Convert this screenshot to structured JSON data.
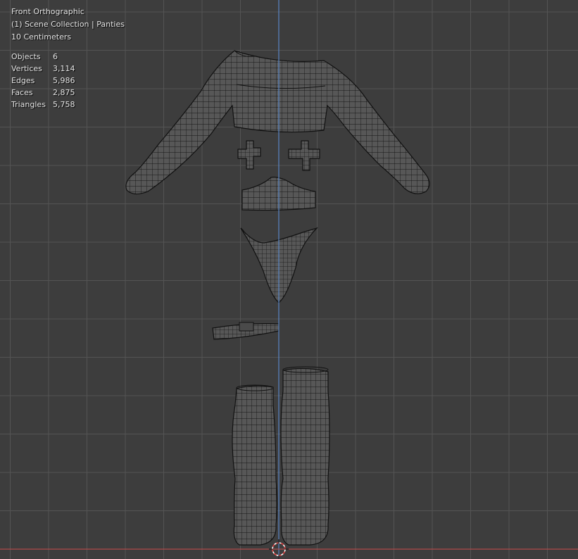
{
  "viewport": {
    "view_name": "Front Orthographic",
    "collection_line": "(1) Scene Collection | Panties",
    "grid_scale": "10 Centimeters"
  },
  "stats": [
    {
      "label": "Objects",
      "value": "6"
    },
    {
      "label": "Vertices",
      "value": "3,114"
    },
    {
      "label": "Edges",
      "value": "5,986"
    },
    {
      "label": "Faces",
      "value": "2,875"
    },
    {
      "label": "Triangles",
      "value": "5,758"
    }
  ],
  "colors": {
    "background": "#3d3d3d",
    "grid": "#545454",
    "z_axis": "#5b86c4",
    "x_axis": "#b04a4a",
    "wire": "#111111",
    "mesh_fill": "#555555",
    "cursor": "#ffffff",
    "cursor_red": "#e04040"
  },
  "objects": [
    {
      "name": "Sweater"
    },
    {
      "name": "Pasties"
    },
    {
      "name": "Bra"
    },
    {
      "name": "Panties"
    },
    {
      "name": "Choker"
    },
    {
      "name": "Stockings"
    }
  ]
}
